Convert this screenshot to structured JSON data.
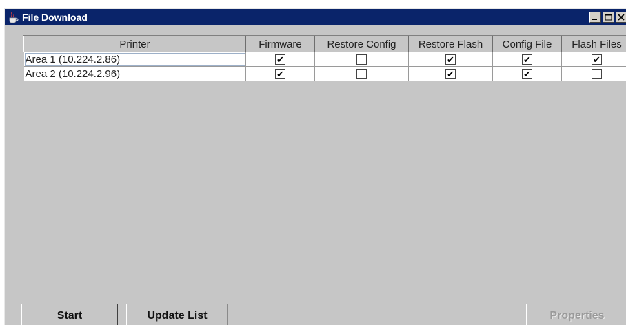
{
  "window": {
    "title": "File Download"
  },
  "title_controls": [
    {
      "name": "minimize",
      "icon": "minimize-icon"
    },
    {
      "name": "maximize",
      "icon": "maximize-icon"
    },
    {
      "name": "close",
      "icon": "close-icon"
    }
  ],
  "table": {
    "columns": [
      "Printer",
      "Firmware",
      "Restore Config",
      "Restore Flash",
      "Config File",
      "Flash Files"
    ],
    "rows": [
      {
        "printer": "Area 1 (10.224.2.86)",
        "firmware": true,
        "restore_config": false,
        "restore_flash": true,
        "config_file": true,
        "flash_files": true
      },
      {
        "printer": "Area 2 (10.224.2.96)",
        "firmware": true,
        "restore_config": false,
        "restore_flash": true,
        "config_file": true,
        "flash_files": false
      }
    ]
  },
  "buttons": {
    "start": "Start",
    "update_list": "Update List",
    "properties": "Properties"
  },
  "colors": {
    "titlebar": "#0a246a",
    "panel": "#c6c6c6",
    "disabled_text": "#9a9a9a"
  }
}
